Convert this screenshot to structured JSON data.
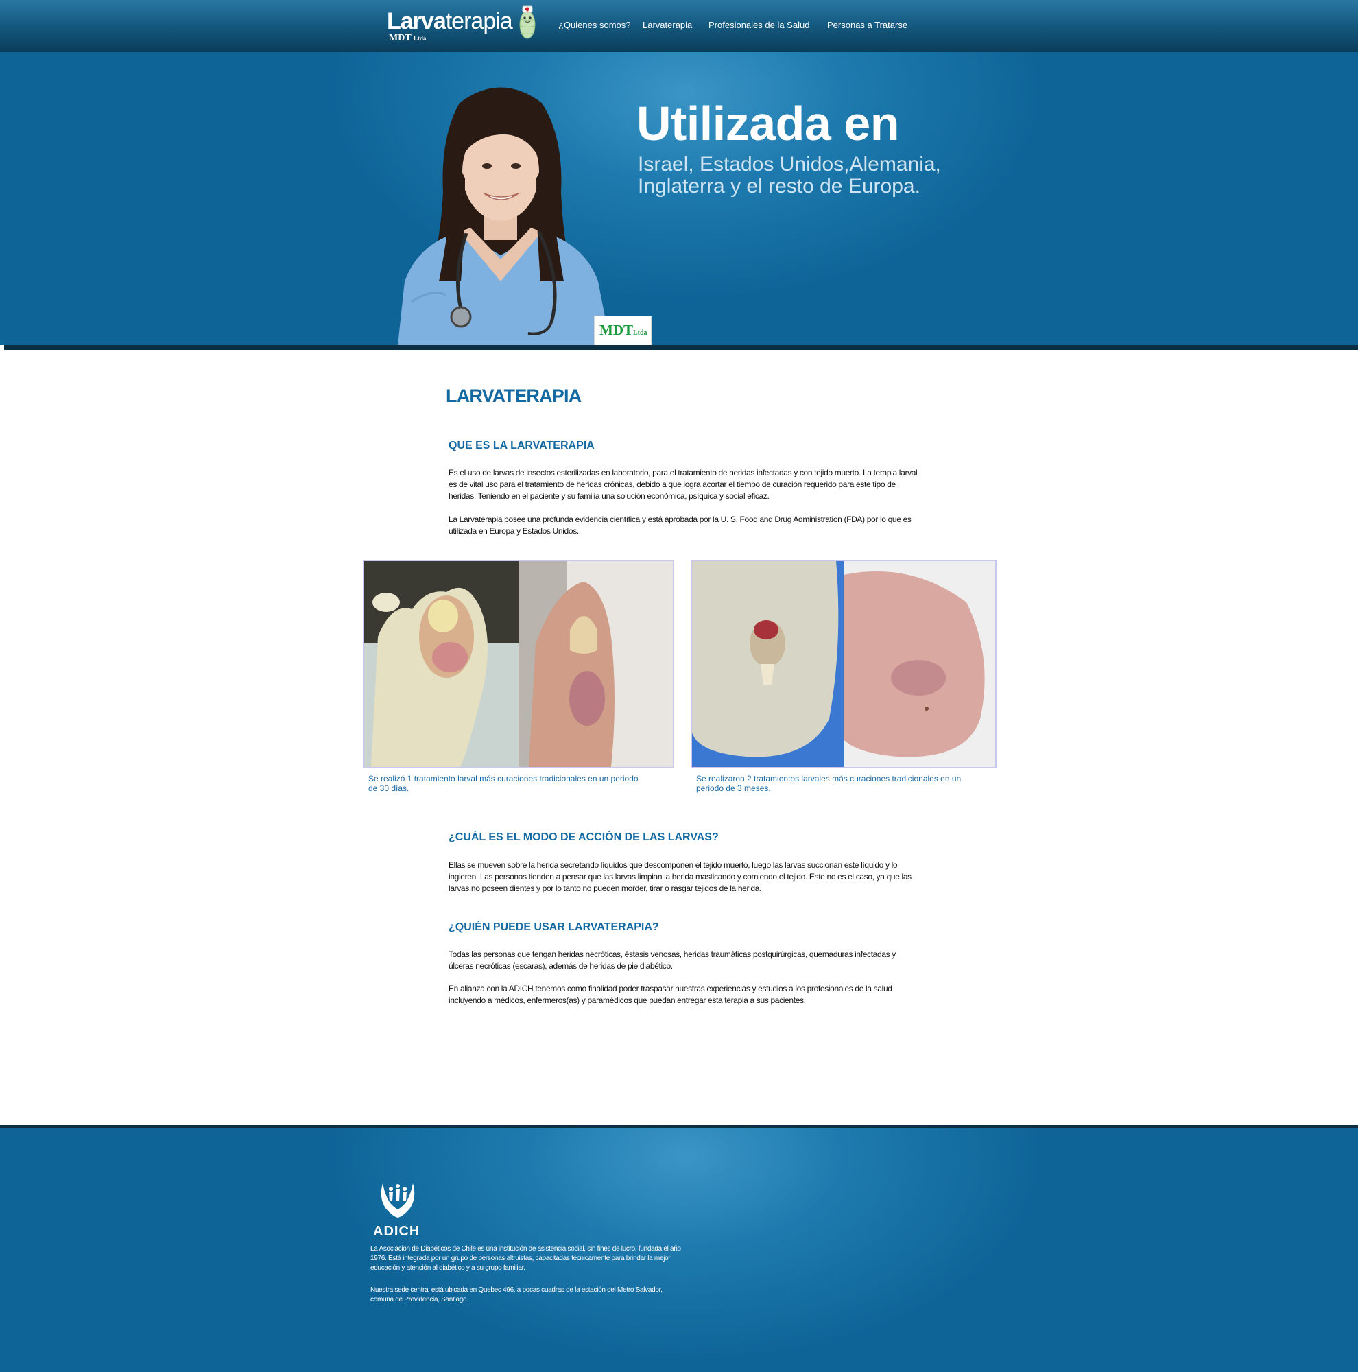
{
  "brand": {
    "logo_bold": "Larva",
    "logo_light": "terapia",
    "logo_sub": "MDT",
    "logo_sub_small": "Ltda"
  },
  "nav": {
    "items": [
      {
        "label": "¿Quienes somos?"
      },
      {
        "label": "Larvaterapia"
      },
      {
        "label": "Profesionales de la Salud"
      },
      {
        "label": "Personas a Tratarse"
      }
    ]
  },
  "hero": {
    "title": "Utilizada en",
    "subtitle_line1": "Israel, Estados Unidos,Alemania,",
    "subtitle_line2": "Inglaterra y el resto de Europa.",
    "badge": "MDT",
    "badge_small": "Ltda"
  },
  "content": {
    "heading": "LARVATERAPIA",
    "section1": {
      "title": "QUE ES LA LARVATERAPIA",
      "para1": "Es el uso de larvas de insectos esterilizadas en laboratorio, para el tratamiento de heridas infectadas y con tejido muerto. La terapia larval es de vital uso para el tratamiento de heridas crónicas, debido a que logra acortar el tiempo de curación requerido para este tipo de heridas. Teniendo en el paciente y su familia una solución económica, psíquica y social eficaz.",
      "para2": "La Larvaterapia posee una profunda evidencia científica y está aprobada por la U. S. Food and Drug Administration (FDA) por lo que es utilizada en Europa y Estados Unidos."
    },
    "photos": [
      {
        "caption": "Se realizó 1 tratamiento larval más curaciones tradicionales en un periodo de 30 días."
      },
      {
        "caption": "Se realizaron 2 tratamientos larvales más curaciones tradicionales en un periodo de 3 meses."
      }
    ],
    "section2": {
      "title": "¿CUÁL ES EL MODO DE ACCIÓN DE LAS LARVAS?",
      "para1": "Ellas se mueven sobre la herida secretando líquidos que descomponen el tejido muerto, luego las larvas succionan este líquido y lo ingieren.  Las personas tienden a pensar que las larvas limpian la herida masticando y comiendo el tejido. Este no es el caso, ya que las larvas no poseen dientes y por lo tanto no pueden morder, tirar o rasgar tejidos de la herida."
    },
    "section3": {
      "title": "¿QUIÉN PUEDE USAR LARVATERAPIA?",
      "para1": "Todas las personas que tengan heridas necróticas, éstasis venosas, heridas traumáticas postquirúrgicas, quemaduras infectadas y úlceras necróticas (escaras), además de heridas de pie diabético.",
      "para2": "En alianza con la ADICH tenemos como finalidad poder traspasar nuestras experiencias y estudios a los profesionales de la salud incluyendo a médicos, enfermeros(as) y paramédicos que puedan entregar esta terapia a sus pacientes."
    }
  },
  "footer": {
    "org_name": "ADICH",
    "text1": "La Asociación de Diabéticos de Chile es una institución de asistencia social, sin fines de lucro, fundada el año 1976. Está integrada por un grupo de personas altruistas, capacitadas técnicamente para brindar la mejor educación y atención al diabético y a su grupo familiar.",
    "text2": "Nuestra sede central está ubicada en Quebec 496, a pocas cuadras de la estación del Metro Salvador, comuna de Providencia, Santiago."
  },
  "icons": {
    "larva_mascot": "larva-mascot-icon",
    "adich_hands": "hands-logo-icon"
  },
  "colors": {
    "accent_blue": "#1369a2",
    "badge_green": "#1b9a3c",
    "hero_blue": "#1e7aae"
  }
}
